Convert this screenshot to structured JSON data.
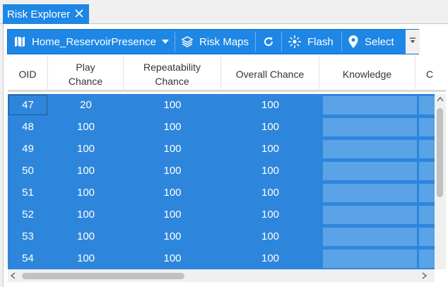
{
  "tab": {
    "title": "Risk Explorer",
    "close_icon": "close-icon"
  },
  "toolbar": {
    "layer_name": "Home_ReservoirPresence",
    "risk_maps_label": "Risk Maps",
    "flash_label": "Flash",
    "select_label": "Select"
  },
  "columns": [
    {
      "label": "OID"
    },
    {
      "label": "Play\nChance"
    },
    {
      "label": "Repeatability\nChance"
    },
    {
      "label": "Overall Chance"
    },
    {
      "label": "Knowledge"
    },
    {
      "label": "C"
    }
  ],
  "rows": [
    {
      "oid": "47",
      "play": "20",
      "repeat": "100",
      "overall": "100"
    },
    {
      "oid": "48",
      "play": "100",
      "repeat": "100",
      "overall": "100"
    },
    {
      "oid": "49",
      "play": "100",
      "repeat": "100",
      "overall": "100"
    },
    {
      "oid": "50",
      "play": "100",
      "repeat": "100",
      "overall": "100"
    },
    {
      "oid": "51",
      "play": "100",
      "repeat": "100",
      "overall": "100"
    },
    {
      "oid": "52",
      "play": "100",
      "repeat": "100",
      "overall": "100"
    },
    {
      "oid": "53",
      "play": "100",
      "repeat": "100",
      "overall": "100"
    },
    {
      "oid": "54",
      "play": "100",
      "repeat": "100",
      "overall": "100"
    }
  ],
  "colors": {
    "accent": "#1e87e5",
    "selection": "#2e86dc",
    "knowledge_cell": "#5aa3e6"
  }
}
